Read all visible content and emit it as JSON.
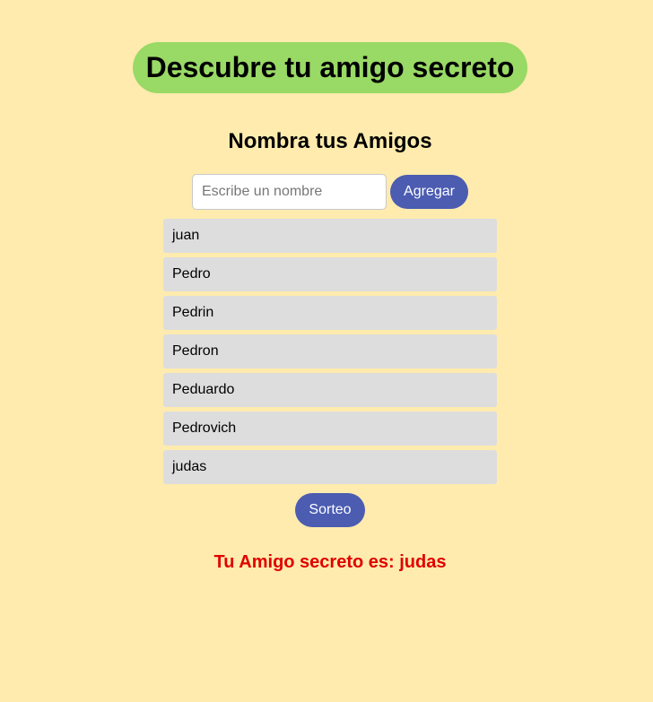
{
  "header": {
    "title": "Descubre tu amigo secreto"
  },
  "input_section": {
    "subtitle": "Nombra tus Amigos",
    "name_input": {
      "value": "",
      "placeholder": "Escribe un nombre"
    },
    "add_button_label": "Agregar"
  },
  "friends": [
    "juan",
    "Pedro",
    "Pedrin",
    "Pedron",
    "Peduardo",
    "Pedrovich",
    "judas"
  ],
  "draw_button_label": "Sorteo",
  "result_text": "Tu Amigo secreto es: judas",
  "colors": {
    "background": "#ffebad",
    "title_pill": "#99d965",
    "button": "#4b5cb1",
    "list_item": "#dddddd",
    "result": "#e00000"
  }
}
